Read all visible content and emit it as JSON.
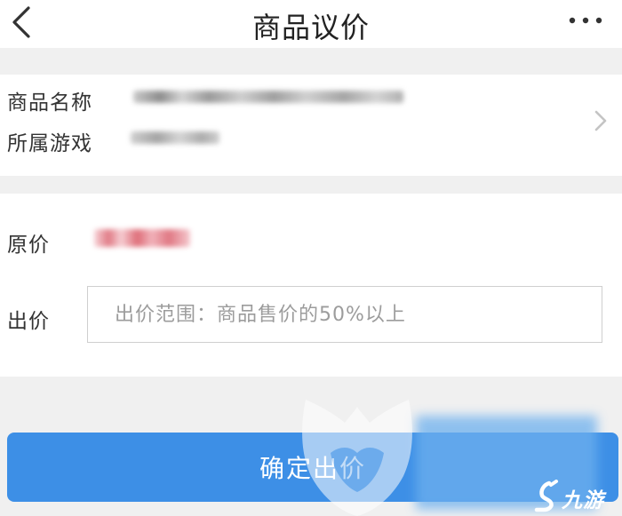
{
  "header": {
    "title": "商品议价",
    "back_icon": "chevron-left-icon",
    "more_icon": "more-horizontal-icon"
  },
  "product": {
    "name_label": "商品名称",
    "game_label": "所属游戏",
    "chevron_icon": "chevron-right-icon"
  },
  "price": {
    "original_label": "原价",
    "bid_label": "出价",
    "bid_placeholder": "出价范围：商品售价的50%以上",
    "bid_value": ""
  },
  "actions": {
    "confirm_label": "确定出价"
  },
  "watermark": {
    "logo_text": "九游"
  },
  "colors": {
    "primary": "#3d8fe6",
    "page_background": "#f0f0f0",
    "price_highlight": "#e07a85"
  }
}
